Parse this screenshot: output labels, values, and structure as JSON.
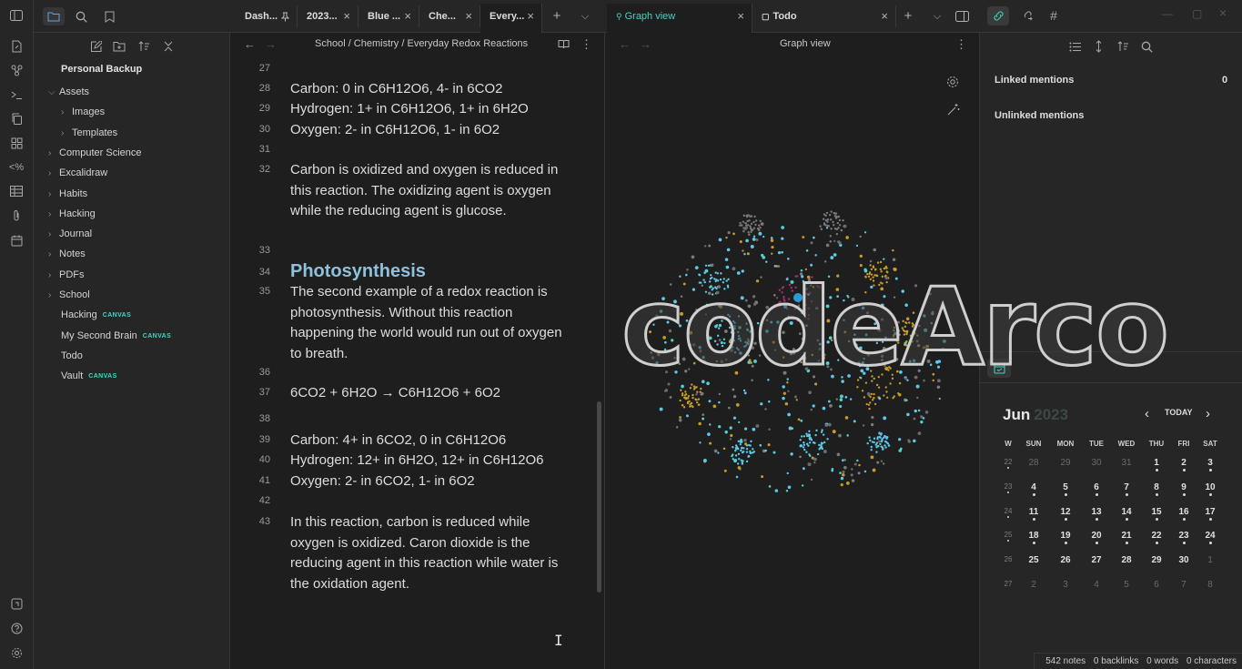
{
  "sidebar": {
    "vault_name": "Personal Backup",
    "items": [
      {
        "label": "Assets",
        "chev": "⌵",
        "badge": ""
      },
      {
        "label": "Images",
        "chev": "›",
        "badge": ""
      },
      {
        "label": "Templates",
        "chev": "›",
        "badge": ""
      },
      {
        "label": "Computer Science",
        "chev": "›",
        "badge": ""
      },
      {
        "label": "Excalidraw",
        "chev": "›",
        "badge": ""
      },
      {
        "label": "Habits",
        "chev": "›",
        "badge": ""
      },
      {
        "label": "Hacking",
        "chev": "›",
        "badge": ""
      },
      {
        "label": "Journal",
        "chev": "›",
        "badge": ""
      },
      {
        "label": "Notes",
        "chev": "›",
        "badge": ""
      },
      {
        "label": "PDFs",
        "chev": "›",
        "badge": ""
      },
      {
        "label": "School",
        "chev": "›",
        "badge": ""
      },
      {
        "label": "Hacking",
        "chev": "",
        "badge": "CANVAS"
      },
      {
        "label": "My Second Brain",
        "chev": "",
        "badge": "CANVAS"
      },
      {
        "label": "Todo",
        "chev": "",
        "badge": ""
      },
      {
        "label": "Vault",
        "chev": "",
        "badge": "CANVAS"
      }
    ]
  },
  "tabs_left": [
    {
      "label": "Dash..."
    },
    {
      "label": "2023..."
    },
    {
      "label": "Blue ..."
    },
    {
      "label": "Che..."
    },
    {
      "label": "Every..."
    }
  ],
  "tabs_right": [
    {
      "label": "Graph view"
    },
    {
      "label": "Todo"
    }
  ],
  "editor": {
    "breadcrumb": "School / Chemistry / Everyday Redox Reactions",
    "lines": [
      {
        "num": "27",
        "text": ""
      },
      {
        "num": "28",
        "text": "Carbon: 0 in C6H12O6, 4- in 6CO2"
      },
      {
        "num": "29",
        "text": "Hydrogen: 1+ in C6H12O6, 1+ in 6H2O"
      },
      {
        "num": "30",
        "text": "Oxygen: 2- in C6H12O6, 1- in 6O2"
      },
      {
        "num": "31",
        "text": ""
      },
      {
        "num": "32",
        "text": "Carbon is oxidized and oxygen is reduced in this reaction. The oxidizing agent is oxygen while the reducing agent is glucose."
      },
      {
        "num": "33",
        "text": ""
      },
      {
        "num": "34",
        "text": "Photosynthesis"
      },
      {
        "num": "35",
        "text": "The second example of a redox reaction is photosynthesis. Without this reaction happening the world would run out of oxygen to breath."
      },
      {
        "num": "36",
        "text": ""
      },
      {
        "num": "37",
        "text": "6CO2 + 6H2O → C6H12O6 + 6O2"
      },
      {
        "num": "38",
        "text": ""
      },
      {
        "num": "39",
        "text": "Carbon: 4+ in 6CO2, 0 in C6H12O6"
      },
      {
        "num": "40",
        "text": "Hydrogen: 12+ in 6H2O, 12+ in C6H12O6"
      },
      {
        "num": "41",
        "text": "Oxygen: 2- in 6CO2, 1- in 6O2"
      },
      {
        "num": "42",
        "text": ""
      },
      {
        "num": "43",
        "text": "In this reaction, carbon is reduced while oxygen is oxidized. Caron dioxide is the reducing agent in this reaction while water is the oxidation agent."
      }
    ]
  },
  "graph": {
    "title": "Graph view"
  },
  "backlinks": {
    "linked_label": "Linked mentions",
    "linked_count": "0",
    "unlinked_label": "Unlinked mentions"
  },
  "calendar": {
    "month": "Jun",
    "year": "2023",
    "today_label": "TODAY",
    "weekdays": [
      "W",
      "SUN",
      "MON",
      "TUE",
      "WED",
      "THU",
      "FRI",
      "SAT"
    ],
    "weeks": [
      [
        "22",
        "28",
        "29",
        "30",
        "31",
        "1",
        "2",
        "3"
      ],
      [
        "23",
        "4",
        "5",
        "6",
        "7",
        "8",
        "9",
        "10"
      ],
      [
        "24",
        "11",
        "12",
        "13",
        "14",
        "15",
        "16",
        "17"
      ],
      [
        "25",
        "18",
        "19",
        "20",
        "21",
        "22",
        "23",
        "24"
      ],
      [
        "26",
        "25",
        "26",
        "27",
        "28",
        "29",
        "30",
        "1"
      ],
      [
        "27",
        "2",
        "3",
        "4",
        "5",
        "6",
        "7",
        "8"
      ]
    ]
  },
  "status": {
    "notes": "542 notes",
    "backlinks": "0 backlinks",
    "words": "0 words",
    "chars": "0 characters"
  },
  "watermark": "codeArco",
  "colors": {
    "accent": "#3fd7c2",
    "heading": "#8fc1dc",
    "bg": "#1e1e1e",
    "panel": "#262626"
  }
}
